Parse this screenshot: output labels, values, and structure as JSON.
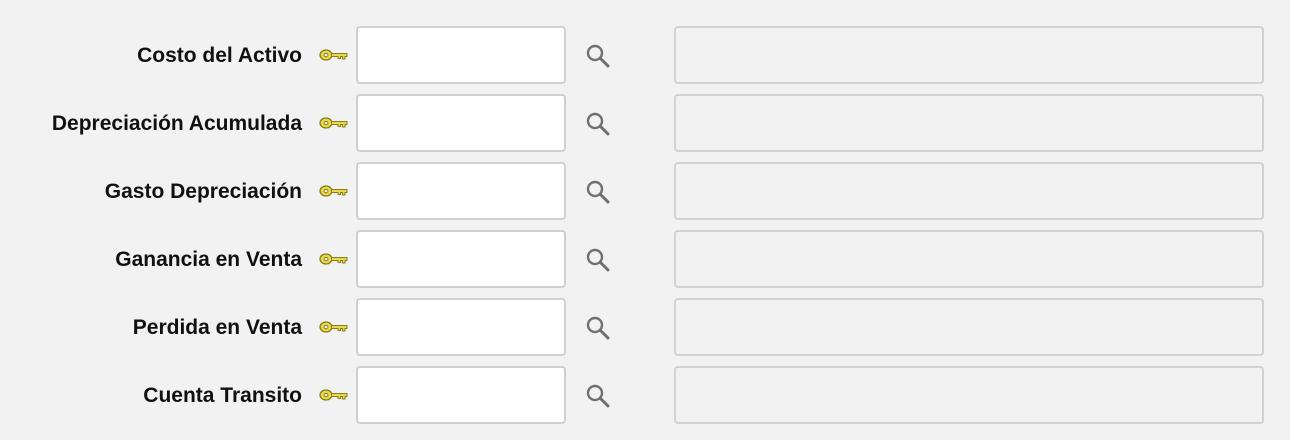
{
  "fields": [
    {
      "label": "Costo del Activo",
      "value": "",
      "description": ""
    },
    {
      "label": "Depreciación Acumulada",
      "value": "",
      "description": ""
    },
    {
      "label": "Gasto Depreciación",
      "value": "",
      "description": ""
    },
    {
      "label": "Ganancia en Venta",
      "value": "",
      "description": ""
    },
    {
      "label": "Perdida en Venta",
      "value": "",
      "description": ""
    },
    {
      "label": "Cuenta Transito",
      "value": "",
      "description": ""
    }
  ],
  "icons": {
    "required": "key-icon",
    "lookup": "search-icon"
  },
  "colors": {
    "background": "#f2f2f2",
    "key": "#d8c84a",
    "input_border": "#cfcfcf"
  }
}
